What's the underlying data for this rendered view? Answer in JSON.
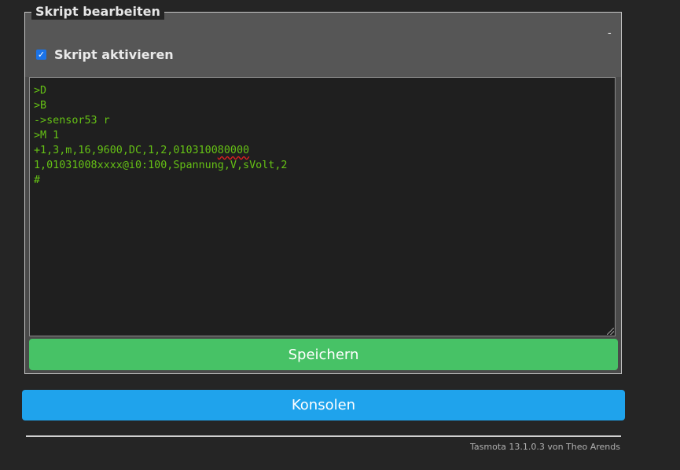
{
  "fieldset": {
    "legend": "Skript bearbeiten",
    "dash": "-"
  },
  "checkbox": {
    "label": "Skript aktivieren",
    "checked": true
  },
  "editor": {
    "lines": [
      ">D",
      ">B",
      "->sensor53 r",
      ">M 1",
      "+1,3,m,16,9600,DC,1,2,010310080000",
      "1,01031008xxxx@i0:100,Spannung,V,sVolt,2",
      "#"
    ],
    "line5_prefix": "+1,3,m,16,9600,DC,1,2,0103100",
    "line5_marked": "80000"
  },
  "buttons": {
    "save_label": "Speichern",
    "console_label": "Konsolen"
  },
  "footer": {
    "text": "Tasmota 13.1.0.3 von Theo Arends"
  },
  "colors": {
    "save": "#47c266",
    "console": "#1fa3ec",
    "code": "#65c115",
    "spellcheck": "#e02020"
  }
}
